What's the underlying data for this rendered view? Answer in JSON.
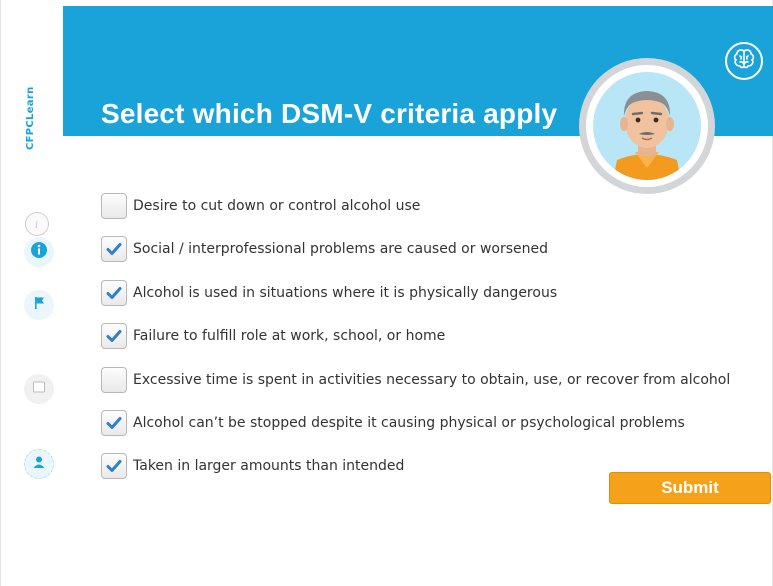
{
  "brand": {
    "logo_text": "CFPCLearn"
  },
  "header": {
    "title": "Select which DSM-V criteria apply",
    "color": "#1aa3d9"
  },
  "icons": {
    "brain": "brain-icon",
    "info_outline": "info-outline-icon",
    "info": "info-icon",
    "flag": "flag-icon",
    "note": "note-icon",
    "profile": "profile-icon",
    "check": "check-icon"
  },
  "criteria": [
    {
      "label": "Desire to cut down or control alcohol use",
      "checked": false
    },
    {
      "label": "Social / interprofessional problems are caused or worsened",
      "checked": true
    },
    {
      "label": "Alcohol is used in situations where it is physically dangerous",
      "checked": true
    },
    {
      "label": "Failure to fulfill role at work, school, or home",
      "checked": true
    },
    {
      "label": "Excessive time is spent in activities necessary to obtain, use, or recover from alcohol",
      "checked": false
    },
    {
      "label": "Alcohol can’t be stopped despite it causing physical or psychological problems",
      "checked": true
    },
    {
      "label": "Taken in larger amounts than intended",
      "checked": true
    }
  ],
  "submit": {
    "label": "Submit",
    "color": "#f6a11a"
  }
}
